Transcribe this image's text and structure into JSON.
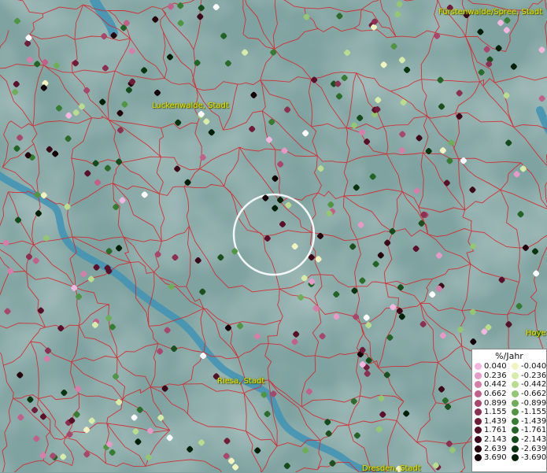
{
  "map": {
    "places": [
      {
        "id": "fuerstenwalde",
        "label": "Fürstenwalde/Spree, Stadt"
      },
      {
        "id": "luckenwalde",
        "label": "Luckenwalde, Stadt"
      },
      {
        "id": "riesa",
        "label": "Riesa, Stadt"
      },
      {
        "id": "dresden",
        "label": "Dresden, Stadt"
      },
      {
        "id": "hoye",
        "label": "Hoye"
      }
    ]
  },
  "legend": {
    "title": "%/Jahr",
    "rows": [
      {
        "pos": {
          "value": "0.040",
          "color": "#f2b6df"
        },
        "neg": {
          "value": "-0.040",
          "color": "#f1f4c0"
        }
      },
      {
        "pos": {
          "value": "0.236",
          "color": "#e79ac7"
        },
        "neg": {
          "value": "-0.236",
          "color": "#d8ecaa"
        }
      },
      {
        "pos": {
          "value": "0.442",
          "color": "#d77da9"
        },
        "neg": {
          "value": "-0.442",
          "color": "#b9dc8f"
        }
      },
      {
        "pos": {
          "value": "0.662",
          "color": "#c26089"
        },
        "neg": {
          "value": "-0.662",
          "color": "#94c774"
        }
      },
      {
        "pos": {
          "value": "0.899",
          "color": "#a8466b"
        },
        "neg": {
          "value": "-0.899",
          "color": "#6fae58"
        }
      },
      {
        "pos": {
          "value": "1.155",
          "color": "#8c2f50"
        },
        "neg": {
          "value": "-1.155",
          "color": "#4f9543"
        }
      },
      {
        "pos": {
          "value": "1.439",
          "color": "#711d3a"
        },
        "neg": {
          "value": "-1.439",
          "color": "#367c33"
        }
      },
      {
        "pos": {
          "value": "1.761",
          "color": "#561128"
        },
        "neg": {
          "value": "-1.761",
          "color": "#226426"
        }
      },
      {
        "pos": {
          "value": "2.143",
          "color": "#3d0919"
        },
        "neg": {
          "value": "-2.143",
          "color": "#134c1a"
        }
      },
      {
        "pos": {
          "value": "2.639",
          "color": "#27030e"
        },
        "neg": {
          "value": "-2.639",
          "color": "#08340f"
        }
      },
      {
        "pos": {
          "value": "3.690",
          "color": "#120006"
        },
        "neg": {
          "value": "-3.690",
          "color": "#021f07"
        }
      }
    ]
  }
}
